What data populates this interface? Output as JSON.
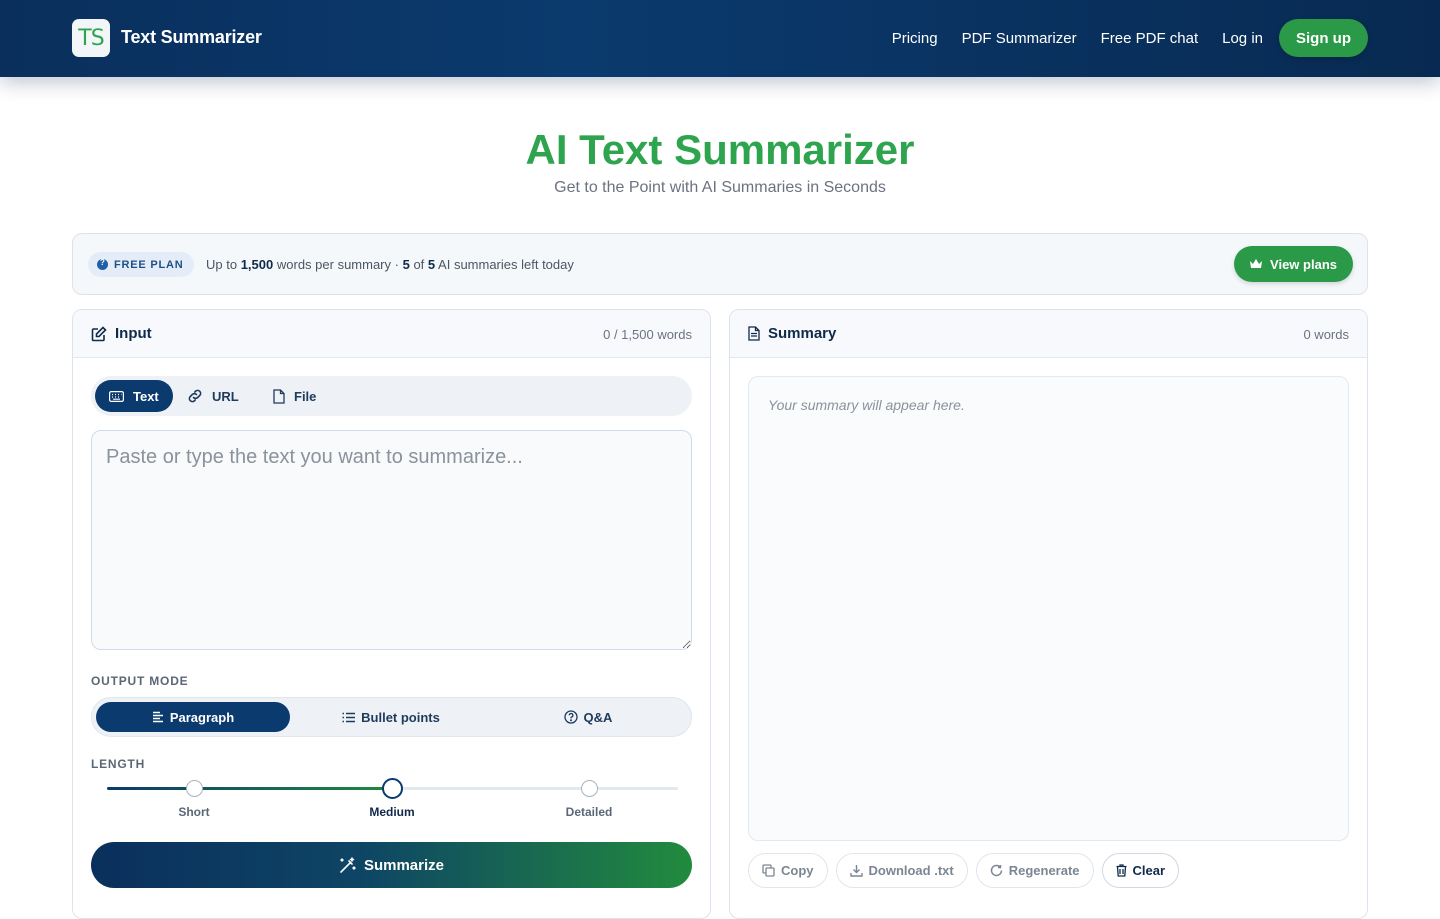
{
  "header": {
    "logo_text": "TS",
    "brand": "Text Summarizer",
    "nav": [
      "Pricing",
      "PDF Summarizer",
      "Free PDF chat",
      "Log in"
    ],
    "signup": "Sign up"
  },
  "hero": {
    "title": "AI Text Summarizer",
    "subtitle": "Get to the Point with AI Summaries in Seconds"
  },
  "plan": {
    "badge": "FREE PLAN",
    "prefix": "Up to",
    "word_limit": "1,500",
    "per_summary": "words per summary ·",
    "left_used": "5",
    "of": "of",
    "left_total": "5",
    "left_suffix": "AI summaries left today",
    "view_plans": "View plans"
  },
  "input_panel": {
    "title": "Input",
    "word_count": "0 / 1,500 words",
    "tabs": [
      {
        "label": "Text",
        "icon": "keyboard-icon",
        "active": true
      },
      {
        "label": "URL",
        "icon": "link-icon",
        "active": false
      },
      {
        "label": "File",
        "icon": "file-icon",
        "active": false
      }
    ],
    "textarea_placeholder": "Paste or type the text you want to summarize...",
    "output_mode_label": "OUTPUT MODE",
    "modes": [
      {
        "label": "Paragraph",
        "icon": "align-left-icon",
        "active": true
      },
      {
        "label": "Bullet points",
        "icon": "list-icon",
        "active": false
      },
      {
        "label": "Q&A",
        "icon": "question-circle-icon",
        "active": false
      }
    ],
    "length_label": "LENGTH",
    "length_stops": [
      "Short",
      "Medium",
      "Detailed"
    ],
    "length_selected": "Medium",
    "summarize": "Summarize"
  },
  "summary_panel": {
    "title": "Summary",
    "word_count": "0 words",
    "placeholder": "Your summary will appear here.",
    "actions": [
      "Copy",
      "Download .txt",
      "Regenerate",
      "Clear"
    ]
  },
  "colors": {
    "brand_green": "#2ea44f",
    "navy": "#0b3a6e"
  }
}
